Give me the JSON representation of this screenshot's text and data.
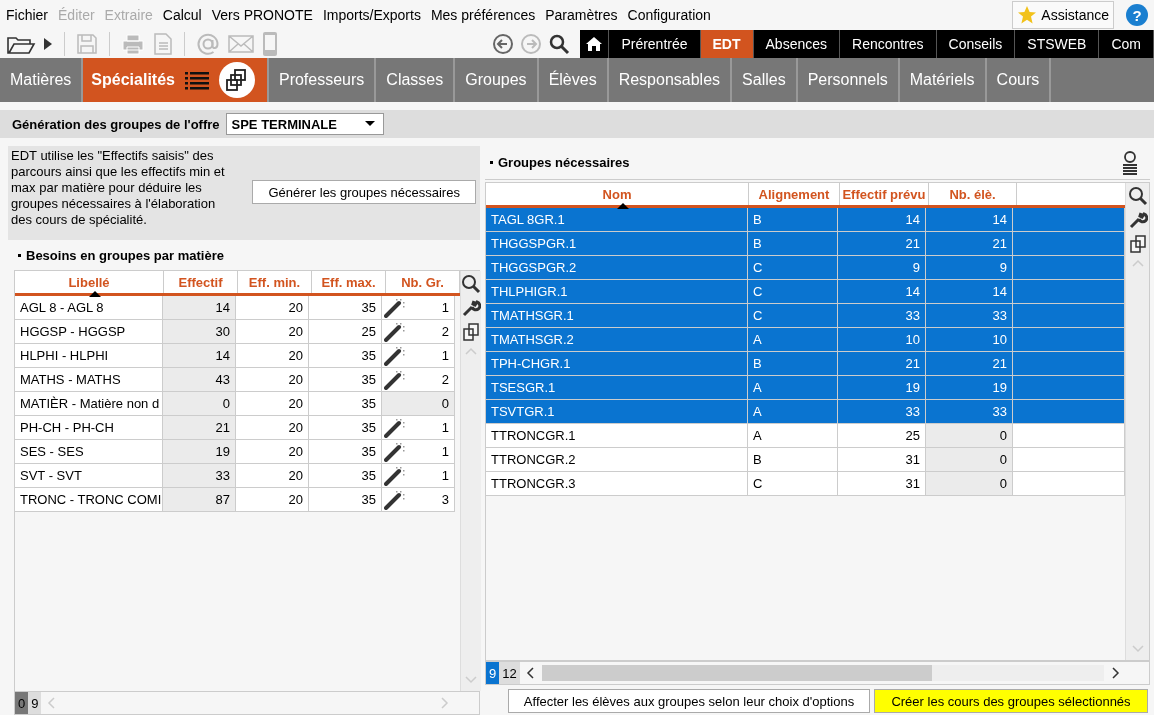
{
  "menu": [
    {
      "label": "Fichier",
      "disabled": false
    },
    {
      "label": "Éditer",
      "disabled": true
    },
    {
      "label": "Extraire",
      "disabled": true
    },
    {
      "label": "Calcul",
      "disabled": false
    },
    {
      "label": "Vers PRONOTE",
      "disabled": false
    },
    {
      "label": "Imports/Exports",
      "disabled": false
    },
    {
      "label": "Mes préférences",
      "disabled": false
    },
    {
      "label": "Paramètres",
      "disabled": false
    },
    {
      "label": "Configuration",
      "disabled": false
    }
  ],
  "assistance": {
    "label": "Assistance",
    "help": "?"
  },
  "modules": [
    {
      "label": "Prérentrée",
      "selected": false
    },
    {
      "label": "EDT",
      "selected": true
    },
    {
      "label": "Absences",
      "selected": false
    },
    {
      "label": "Rencontres",
      "selected": false
    },
    {
      "label": "Conseils",
      "selected": false
    },
    {
      "label": "STSWEB",
      "selected": false
    },
    {
      "label": "Com",
      "selected": false
    }
  ],
  "tabs": [
    {
      "label": "Matières",
      "selected": false
    },
    {
      "label": "Spécialités",
      "selected": true
    },
    {
      "label": "Professeurs",
      "selected": false
    },
    {
      "label": "Classes",
      "selected": false
    },
    {
      "label": "Groupes",
      "selected": false
    },
    {
      "label": "Élèves",
      "selected": false
    },
    {
      "label": "Responsables",
      "selected": false
    },
    {
      "label": "Salles",
      "selected": false
    },
    {
      "label": "Personnels",
      "selected": false
    },
    {
      "label": "Matériels",
      "selected": false
    },
    {
      "label": "Cours",
      "selected": false
    }
  ],
  "offer": {
    "label": "Génération des groupes de l'offre",
    "value": "SPE TERMINALE"
  },
  "description": "EDT utilise les \"Effectifs saisis\" des parcours ainsi que les effectifs min et max par matière pour déduire les groupes nécessaires à l'élaboration des cours de spécialité.",
  "generate_button": "Générer les groupes nécessaires",
  "needs": {
    "title": "Besoins en groupes par matière",
    "columns": [
      "Libellé",
      "Effectif",
      "Eff. min.",
      "Eff. max.",
      "Nb. Gr."
    ],
    "rows": [
      {
        "label": "AGL 8 - AGL 8",
        "effectif": "14",
        "min": "20",
        "max": "35",
        "groups": "1",
        "wand": true
      },
      {
        "label": "HGGSP - HGGSP",
        "effectif": "30",
        "min": "20",
        "max": "25",
        "groups": "2",
        "wand": true
      },
      {
        "label": "HLPHI - HLPHI",
        "effectif": "14",
        "min": "20",
        "max": "35",
        "groups": "1",
        "wand": true
      },
      {
        "label": "MATHS - MATHS",
        "effectif": "43",
        "min": "20",
        "max": "35",
        "groups": "2",
        "wand": true
      },
      {
        "label": "MATIÈR - Matière non d",
        "effectif": "0",
        "min": "20",
        "max": "35",
        "groups": "0",
        "wand": false
      },
      {
        "label": "PH-CH - PH-CH",
        "effectif": "21",
        "min": "20",
        "max": "35",
        "groups": "1",
        "wand": true
      },
      {
        "label": "SES - SES",
        "effectif": "19",
        "min": "20",
        "max": "35",
        "groups": "1",
        "wand": true
      },
      {
        "label": "SVT - SVT",
        "effectif": "33",
        "min": "20",
        "max": "35",
        "groups": "1",
        "wand": true
      },
      {
        "label": "TRONC - TRONC COMI",
        "effectif": "87",
        "min": "20",
        "max": "35",
        "groups": "3",
        "wand": true
      }
    ],
    "counts": [
      "0",
      "9"
    ]
  },
  "groups": {
    "title": "Groupes nécessaires",
    "columns": [
      "Nom",
      "Alignement",
      "Effectif prévu",
      "Nb. élè."
    ],
    "rows": [
      {
        "name": "TAGL 8GR.1",
        "alignment": "B",
        "planned": "14",
        "students": "14",
        "selected": true
      },
      {
        "name": "THGGSPGR.1",
        "alignment": "B",
        "planned": "21",
        "students": "21",
        "selected": true
      },
      {
        "name": "THGGSPGR.2",
        "alignment": "C",
        "planned": "9",
        "students": "9",
        "selected": true
      },
      {
        "name": "THLPHIGR.1",
        "alignment": "C",
        "planned": "14",
        "students": "14",
        "selected": true
      },
      {
        "name": "TMATHSGR.1",
        "alignment": "C",
        "planned": "33",
        "students": "33",
        "selected": true
      },
      {
        "name": "TMATHSGR.2",
        "alignment": "A",
        "planned": "10",
        "students": "10",
        "selected": true
      },
      {
        "name": "TPH-CHGR.1",
        "alignment": "B",
        "planned": "21",
        "students": "21",
        "selected": true
      },
      {
        "name": "TSESGR.1",
        "alignment": "A",
        "planned": "19",
        "students": "19",
        "selected": true
      },
      {
        "name": "TSVTGR.1",
        "alignment": "A",
        "planned": "33",
        "students": "33",
        "selected": true
      },
      {
        "name": "TTRONCGR.1",
        "alignment": "A",
        "planned": "25",
        "students": "0",
        "selected": false
      },
      {
        "name": "TTRONCGR.2",
        "alignment": "B",
        "planned": "31",
        "students": "0",
        "selected": false
      },
      {
        "name": "TTRONCGR.3",
        "alignment": "C",
        "planned": "31",
        "students": "0",
        "selected": false
      }
    ],
    "counts": [
      "9",
      "12"
    ]
  },
  "assign_button": "Affecter les élèves aux groupes selon leur choix d'options",
  "create_button": "Créer les cours des groupes sélectionnés"
}
